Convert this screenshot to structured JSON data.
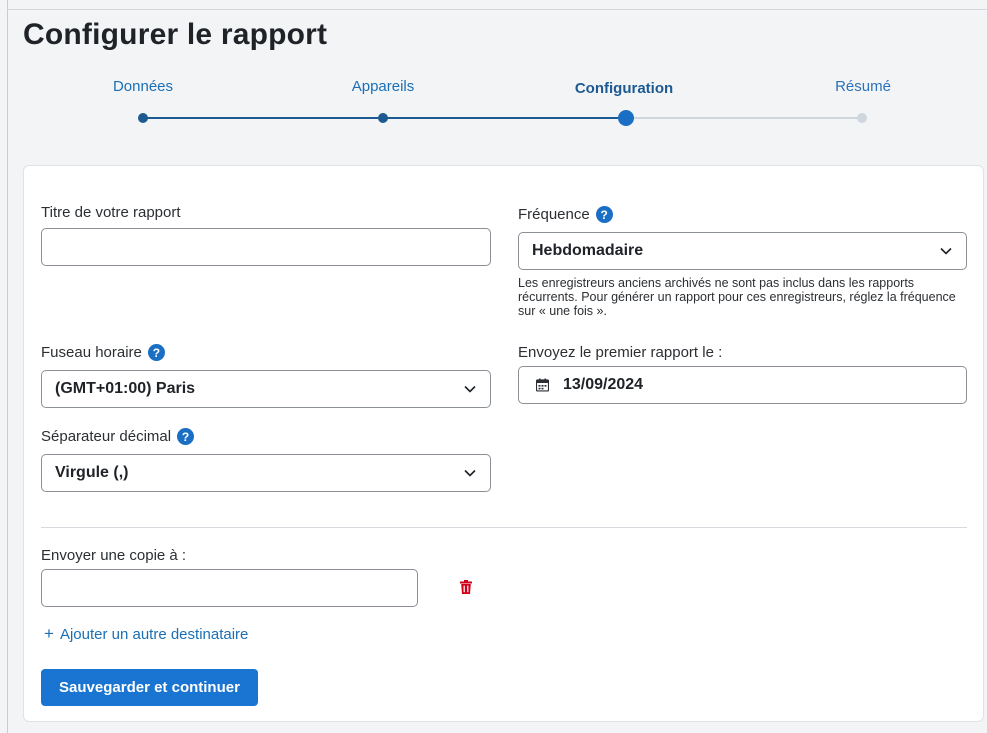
{
  "page": {
    "title": "Configurer le rapport"
  },
  "stepper": {
    "steps": [
      {
        "label": "Données",
        "state": "done"
      },
      {
        "label": "Appareils",
        "state": "done"
      },
      {
        "label": "Configuration",
        "state": "current"
      },
      {
        "label": "Résumé",
        "state": "todo"
      }
    ]
  },
  "form": {
    "report_title": {
      "label": "Titre de votre rapport",
      "value": ""
    },
    "frequency": {
      "label": "Fréquence",
      "value": "Hebdomadaire",
      "note": "Les enregistreurs anciens archivés ne sont pas inclus dans les rapports récurrents. Pour générer un rapport pour ces enregistreurs, réglez la fréquence sur « une fois »."
    },
    "timezone": {
      "label": "Fuseau horaire",
      "value": "(GMT+01:00) Paris"
    },
    "first_report": {
      "label": "Envoyez le premier rapport le :",
      "value": "13/09/2024"
    },
    "decimal_separator": {
      "label": "Séparateur décimal",
      "value": "Virgule (,)"
    },
    "copy_to": {
      "label": "Envoyer une copie à :",
      "value": ""
    },
    "add_recipient": "Ajouter un autre destinataire",
    "save_button": "Sauvegarder et continuer",
    "help_glyph": "?"
  },
  "colors": {
    "accent": "#1a74d1",
    "step_done": "#1d5a92",
    "step_todo": "#cfd6de",
    "danger": "#d0021b"
  }
}
